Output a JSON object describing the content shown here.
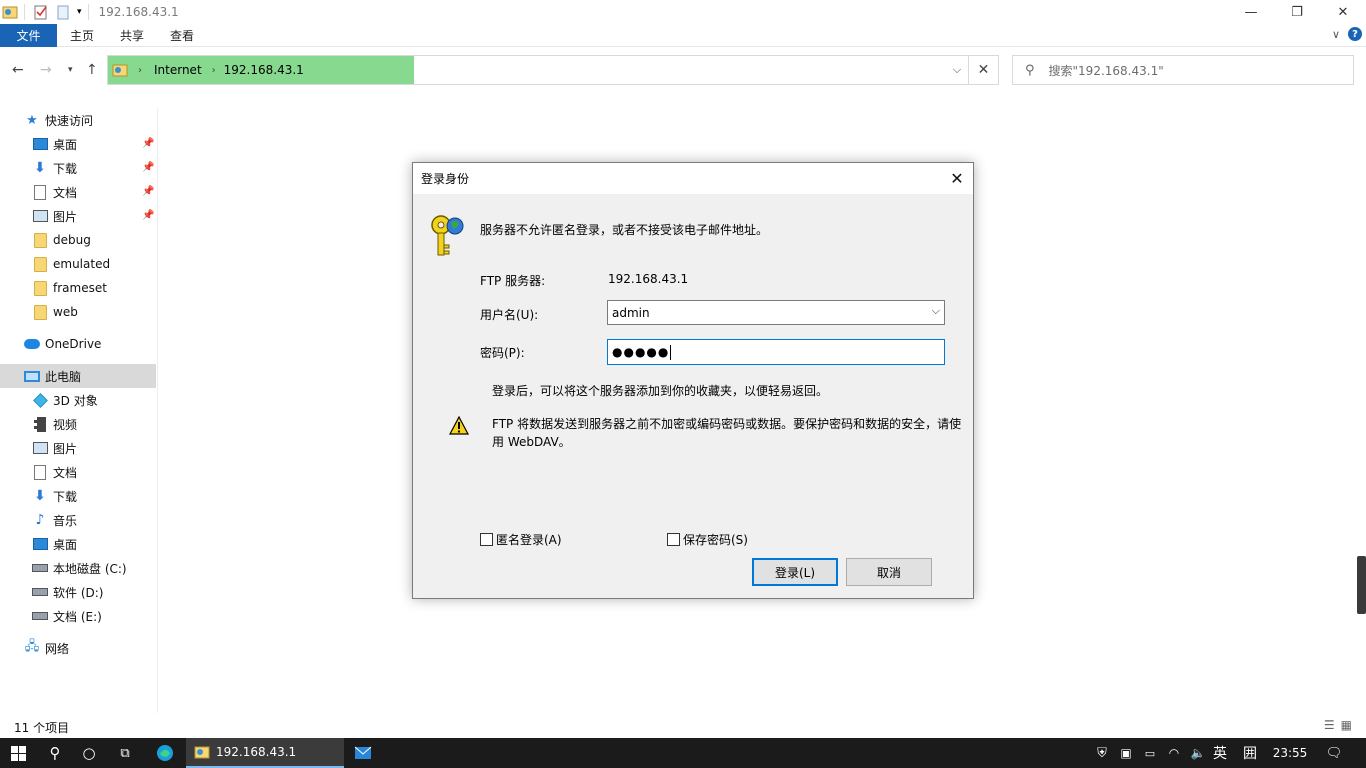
{
  "window": {
    "title": "192.168.43.1",
    "minimize": "—",
    "restore": "❐",
    "close": "✕"
  },
  "ribbon": {
    "tabs": [
      "文件",
      "主页",
      "共享",
      "查看"
    ],
    "collapse": "∨",
    "help": "?"
  },
  "address": {
    "crumbs": [
      "Internet",
      "192.168.43.1"
    ],
    "search_placeholder": "搜索\"192.168.43.1\""
  },
  "sidebar": {
    "quick_access": "快速访问",
    "quick_items": [
      "桌面",
      "下载",
      "文档",
      "图片",
      "debug",
      "emulated",
      "frameset",
      "web"
    ],
    "onedrive": "OneDrive",
    "this_pc": "此电脑",
    "pc_items": [
      "3D 对象",
      "视频",
      "图片",
      "文档",
      "下载",
      "音乐",
      "桌面",
      "本地磁盘 (C:)",
      "软件 (D:)",
      "文档 (E:)"
    ],
    "network": "网络"
  },
  "status": {
    "count": "11 个项目"
  },
  "dialog": {
    "title": "登录身份",
    "message": "服务器不允许匿名登录，或者不接受该电子邮件地址。",
    "ftp_server_label": "FTP 服务器:",
    "ftp_server_value": "192.168.43.1",
    "username_label": "用户名(U):",
    "username_value": "admin",
    "password_label": "密码(P):",
    "password_value": "●●●●●",
    "note": "登录后，可以将这个服务器添加到你的收藏夹，以便轻易返回。",
    "warning": "FTP 将数据发送到服务器之前不加密或编码密码或数据。要保护密码和数据的安全，请使用 WebDAV。",
    "anonymous_label": "匿名登录(A)",
    "save_password_label": "保存密码(S)",
    "login_button": "登录(L)",
    "cancel_button": "取消"
  },
  "taskbar": {
    "active_window": "192.168.43.1",
    "ime_lang": "英",
    "ime_mode": "囲",
    "clock": "23:55"
  },
  "colors": {
    "accent": "#1a64b5",
    "address_highlight": "#86d98e",
    "taskbar": "#1b1b1b"
  }
}
